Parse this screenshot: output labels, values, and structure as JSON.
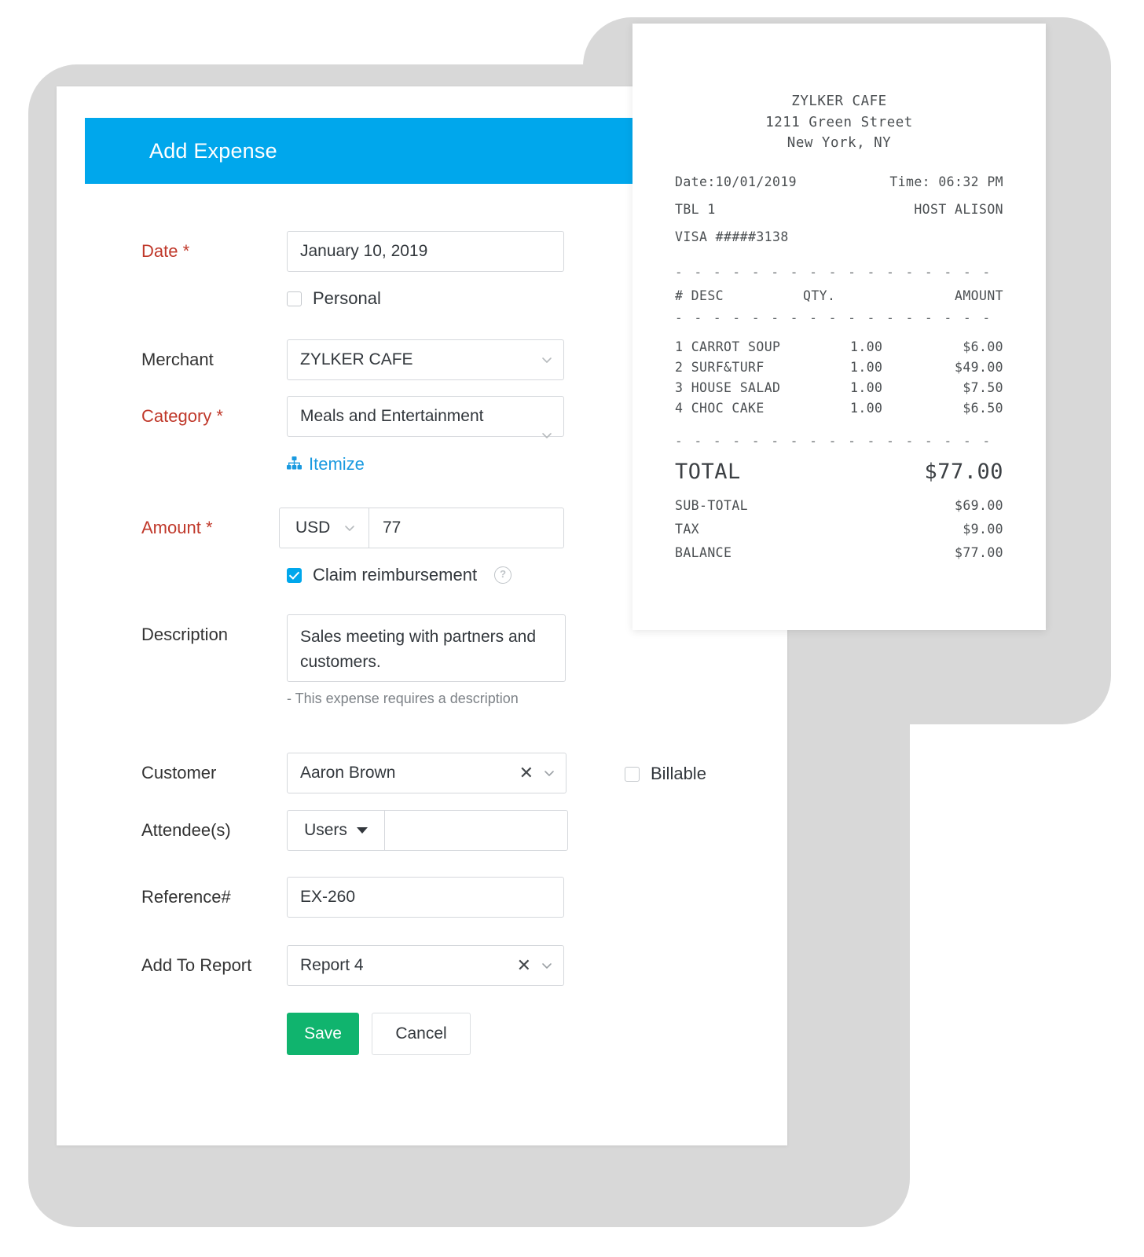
{
  "form": {
    "header_title": "Add Expense",
    "fields": {
      "date": {
        "label": "Date",
        "required_marker": " *",
        "value": "January 10, 2019",
        "personal_checkbox_label": "Personal"
      },
      "merchant": {
        "label": "Merchant",
        "value": "ZYLKER CAFE"
      },
      "category": {
        "label": "Category",
        "required_marker": " *",
        "value": "Meals and Entertainment",
        "itemize_label": "Itemize"
      },
      "amount": {
        "label": "Amount",
        "required_marker": " *",
        "currency": "USD",
        "value": "77",
        "claim_label": "Claim reimbursement",
        "help_glyph": "?"
      },
      "description": {
        "label": "Description",
        "value": "Sales meeting with partners and customers.",
        "hint": "- This expense requires a description"
      },
      "customer": {
        "label": "Customer",
        "value": "Aaron Brown",
        "clear_glyph": "✕",
        "billable_label": "Billable"
      },
      "attendees": {
        "label": "Attendee(s)",
        "selector_value": "Users",
        "value": ""
      },
      "reference": {
        "label": "Reference#",
        "value": "EX-260"
      },
      "report": {
        "label": "Add To Report",
        "value": "Report 4",
        "clear_glyph": "✕"
      }
    },
    "actions": {
      "save_label": "Save",
      "cancel_label": "Cancel"
    },
    "colors": {
      "header_blue": "#00a7ec",
      "save_green": "#10b46e",
      "required_red": "#c0392b",
      "link_blue": "#1a9ae0"
    }
  },
  "receipt": {
    "store_name": "ZYLKER CAFE",
    "address_line1": "1211 Green Street",
    "address_line2": "New York, NY",
    "date_label": "Date:10/01/2019",
    "time_label": "Time: 06:32 PM",
    "table_label": "TBL 1",
    "host_label": "HOST ALISON",
    "card_label": "VISA #####3138",
    "divider": "- - - - - - - - - - - - - - - - - - - - - - - -",
    "columns": {
      "desc": "# DESC",
      "qty": "QTY.",
      "amount": "AMOUNT"
    },
    "items": [
      {
        "num": "1",
        "desc": "CARROT SOUP",
        "qty": "1.00",
        "amount": "$6.00"
      },
      {
        "num": "2",
        "desc": "SURF&TURF",
        "qty": "1.00",
        "amount": "$49.00"
      },
      {
        "num": "3",
        "desc": "HOUSE SALAD",
        "qty": "1.00",
        "amount": "$7.50"
      },
      {
        "num": "4",
        "desc": "CHOC CAKE",
        "qty": "1.00",
        "amount": "$6.50"
      }
    ],
    "total_label": "TOTAL",
    "total_value": "$77.00",
    "summary": [
      {
        "label": "SUB-TOTAL",
        "value": "$69.00"
      },
      {
        "label": "TAX",
        "value": "$9.00"
      },
      {
        "label": "BALANCE",
        "value": "$77.00"
      }
    ]
  }
}
